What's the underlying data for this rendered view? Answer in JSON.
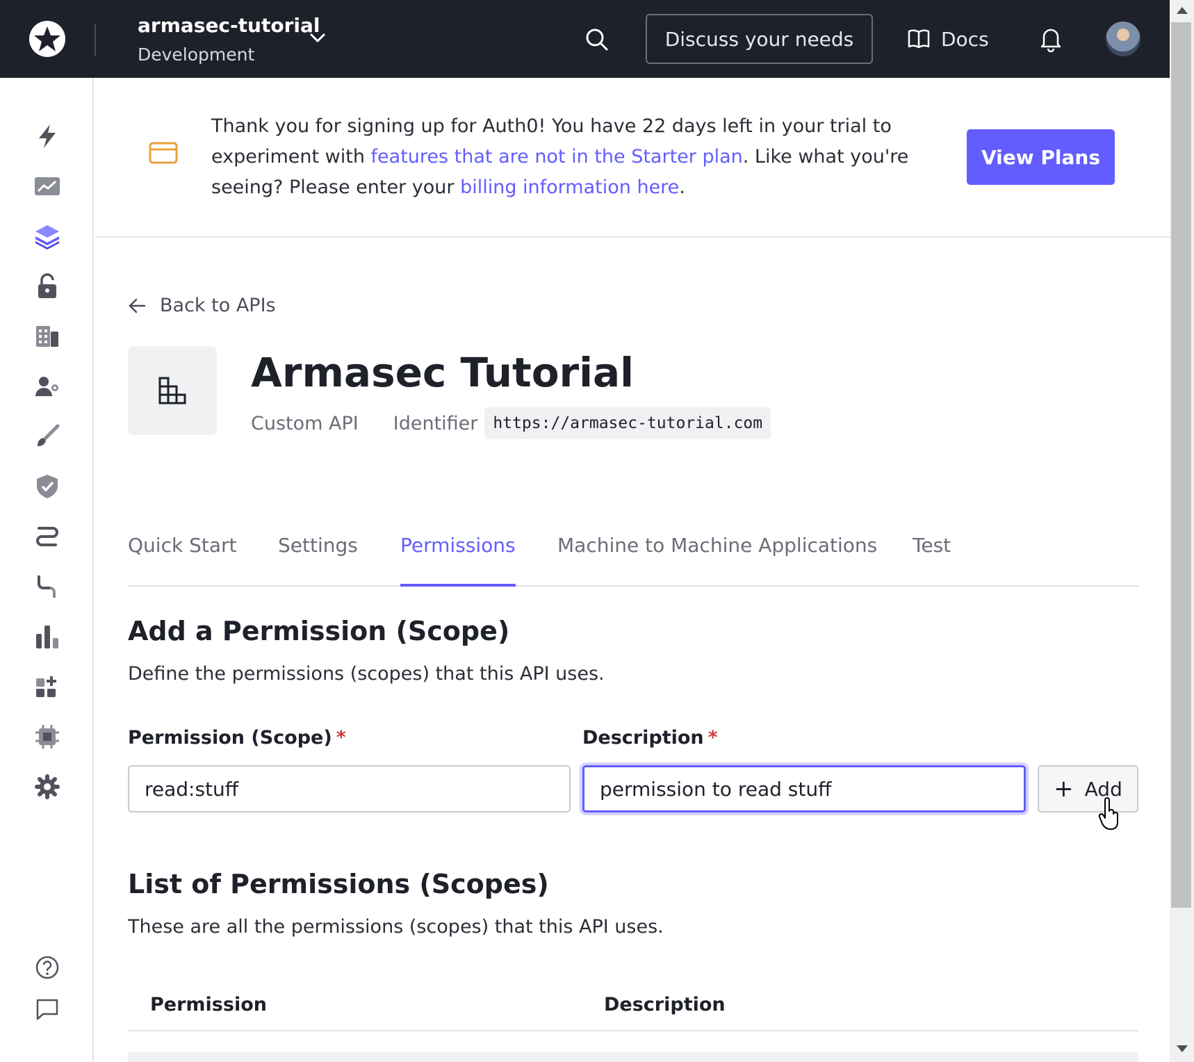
{
  "topbar": {
    "tenant_name": "armasec-tutorial",
    "tenant_env": "Development",
    "discuss_label": "Discuss your needs",
    "docs_label": "Docs"
  },
  "sidebar": {
    "items": [
      {
        "icon": "bolt-icon"
      },
      {
        "icon": "activity-chart-icon"
      },
      {
        "icon": "applications-layers-icon"
      },
      {
        "icon": "authentication-lock-icon"
      },
      {
        "icon": "organizations-icon"
      },
      {
        "icon": "user-management-icon"
      },
      {
        "icon": "branding-brush-icon"
      },
      {
        "icon": "security-shield-icon"
      },
      {
        "icon": "actions-flow-icon"
      },
      {
        "icon": "auth-pipeline-icon"
      },
      {
        "icon": "monitoring-bars-icon"
      },
      {
        "icon": "marketplace-icon"
      },
      {
        "icon": "extensions-chip-icon"
      },
      {
        "icon": "settings-gear-icon"
      },
      {
        "icon": "help-icon"
      },
      {
        "icon": "feedback-icon"
      }
    ]
  },
  "banner": {
    "text_before": "Thank you for signing up for Auth0! You have 22 days left in your trial to experiment with ",
    "link1": "features that are not in the Starter plan",
    "text_middle": ". Like what you're seeing? Please enter your ",
    "link2": "billing information here",
    "text_after": ".",
    "button_label": "View Plans"
  },
  "page": {
    "back_label": "Back to APIs",
    "title": "Armasec Tutorial",
    "api_type": "Custom API",
    "identifier_label": "Identifier",
    "identifier_value": "https://armasec-tutorial.com"
  },
  "tabs": [
    {
      "label": "Quick Start",
      "active": false
    },
    {
      "label": "Settings",
      "active": false
    },
    {
      "label": "Permissions",
      "active": true
    },
    {
      "label": "Machine to Machine Applications",
      "active": false
    },
    {
      "label": "Test",
      "active": false
    }
  ],
  "add_section": {
    "title": "Add a Permission (Scope)",
    "description": "Define the permissions (scopes) that this API uses.",
    "scope_label": "Permission (Scope)",
    "scope_value": "read:stuff",
    "desc_label": "Description",
    "desc_value": "permission to read stuff",
    "required_mark": "*",
    "add_plus": "+",
    "add_label": "Add"
  },
  "list_section": {
    "title": "List of Permissions (Scopes)",
    "description": "These are all the permissions (scopes) that this API uses.",
    "columns": [
      "Permission",
      "Description"
    ]
  },
  "colors": {
    "accent": "#635dff",
    "topbar": "#1e212a",
    "required": "#d03c38"
  }
}
